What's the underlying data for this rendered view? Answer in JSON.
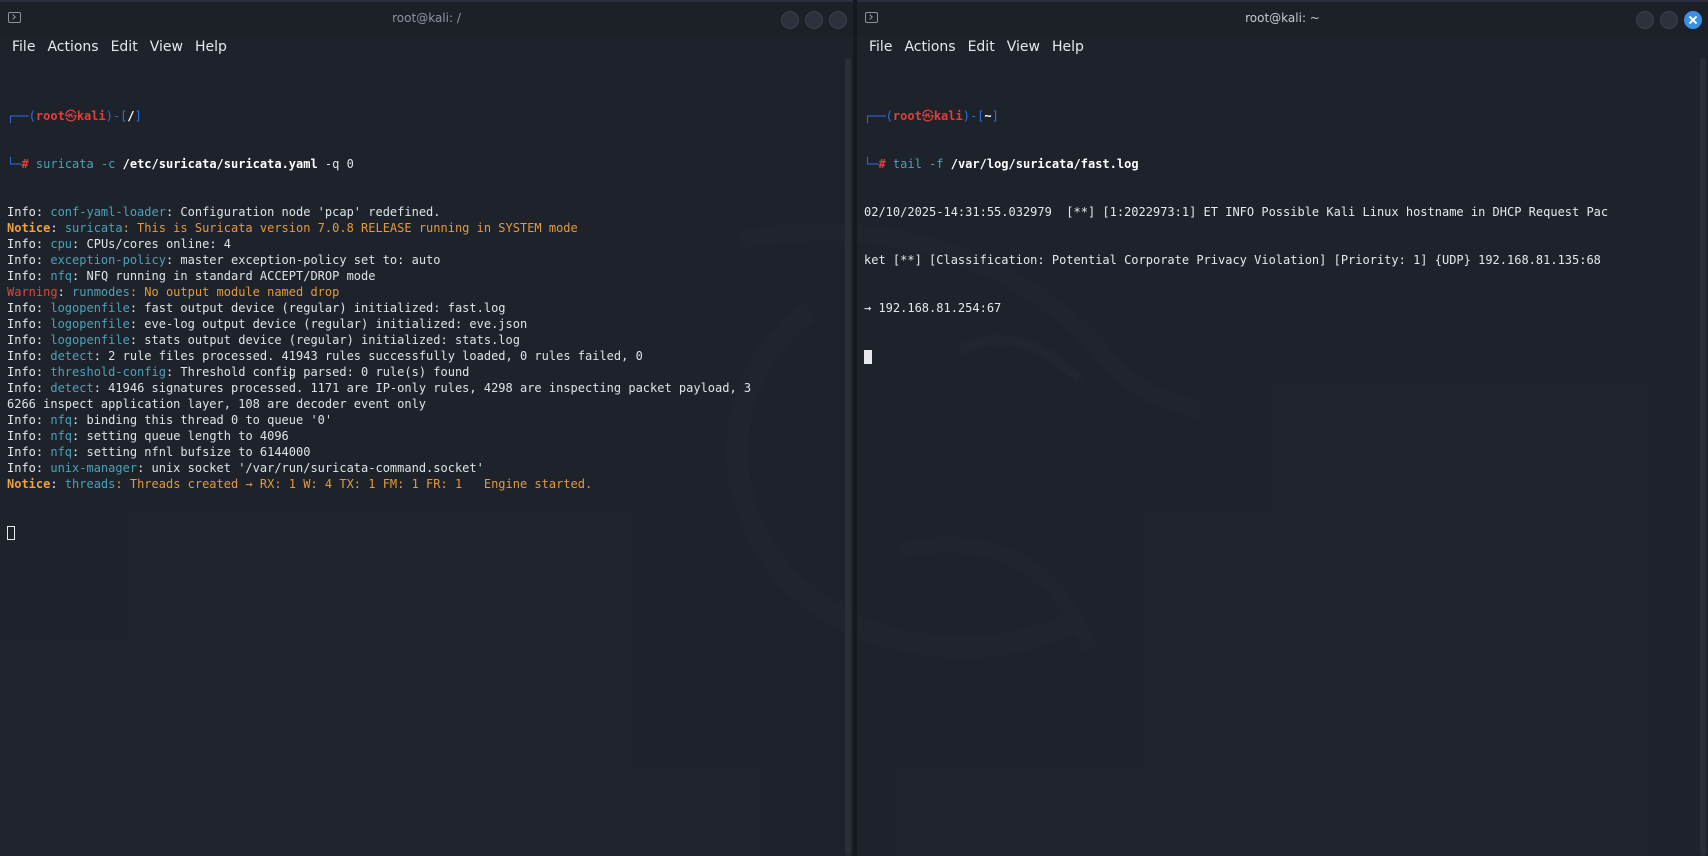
{
  "colors": {
    "background": "#1f232b",
    "prompt_frame": "#2f6fe0",
    "prompt_user": "#e0403a",
    "notice": "#e39a3c",
    "warning": "#d84b3c",
    "module": "#5fb7a8",
    "close_active": "#3a8fe8"
  },
  "icons": {
    "window_icon": "terminal-icon",
    "close": "close-icon"
  },
  "left_window": {
    "title": "root@kali: /",
    "menu": [
      "File",
      "Actions",
      "Edit",
      "View",
      "Help"
    ],
    "prompt": {
      "frame_open": "┌──(",
      "user": "root",
      "skull": "㉿",
      "host": "kali",
      "frame_mid": ")-[",
      "path": "/",
      "frame_close": "]",
      "hash_prefix": "└─",
      "hash": "#",
      "command": "suricata -c ",
      "command_arg": "/etc/suricata/suricata.yaml",
      "command_tail": " -q 0"
    },
    "lines": [
      {
        "level": "Info",
        "module": "conf-yaml-loader",
        "msg": ": Configuration node 'pcap' redefined."
      },
      {
        "level": "Notice",
        "module": "suricata",
        "msg": ": This is Suricata version 7.0.8 RELEASE running in SYSTEM mode"
      },
      {
        "level": "Info",
        "module": "cpu",
        "msg": ": CPUs/cores online: 4"
      },
      {
        "level": "Info",
        "module": "exception-policy",
        "msg": ": master exception-policy set to: auto"
      },
      {
        "level": "Info",
        "module": "nfq",
        "msg": ": NFQ running in standard ACCEPT/DROP mode"
      },
      {
        "level": "Warning",
        "module": "runmodes",
        "msg": ": No output module named drop"
      },
      {
        "level": "Info",
        "module": "logopenfile",
        "msg": ": fast output device (regular) initialized: fast.log"
      },
      {
        "level": "Info",
        "module": "logopenfile",
        "msg": ": eve-log output device (regular) initialized: eve.json"
      },
      {
        "level": "Info",
        "module": "logopenfile",
        "msg": ": stats output device (regular) initialized: stats.log"
      },
      {
        "level": "Info",
        "module": "detect",
        "msg": ": 2 rule files processed. 41943 rules successfully loaded, 0 rules failed, 0"
      },
      {
        "level": "Info",
        "module": "threshold-config",
        "msg": ": Threshold config parsed: 0 rule(s) found"
      },
      {
        "level": "Info",
        "module": "detect",
        "msg": ": 41946 signatures processed. 1171 are IP-only rules, 4298 are inspecting packet payload, 3"
      },
      {
        "level": "",
        "module": "",
        "msg": "6266 inspect application layer, 108 are decoder event only"
      },
      {
        "level": "Info",
        "module": "nfq",
        "msg": ": binding this thread 0 to queue '0'"
      },
      {
        "level": "Info",
        "module": "nfq",
        "msg": ": setting queue length to 4096"
      },
      {
        "level": "Info",
        "module": "nfq",
        "msg": ": setting nfnl bufsize to 6144000"
      },
      {
        "level": "Info",
        "module": "unix-manager",
        "msg": ": unix socket '/var/run/suricata-command.socket'"
      },
      {
        "level": "Notice",
        "module": "threads",
        "msg": ": Threads created → RX: 1 W: 4 TX: 1 FM: 1 FR: 1   Engine started."
      }
    ]
  },
  "right_window": {
    "title": "root@kali: ~",
    "menu": [
      "File",
      "Actions",
      "Edit",
      "View",
      "Help"
    ],
    "prompt": {
      "frame_open": "┌──(",
      "user": "root",
      "skull": "㉿",
      "host": "kali",
      "frame_mid": ")-[",
      "path": "~",
      "frame_close": "]",
      "hash_prefix": "└─",
      "hash": "#",
      "command": "tail -f ",
      "command_arg": "/var/log/suricata/fast.log",
      "command_tail": ""
    },
    "output": [
      "02/10/2025-14:31:55.032979  [**] [1:2022973:1] ET INFO Possible Kali Linux hostname in DHCP Request Pac",
      "ket [**] [Classification: Potential Corporate Privacy Violation] [Priority: 1] {UDP} 192.168.81.135:68",
      "→ 192.168.81.254:67"
    ]
  }
}
